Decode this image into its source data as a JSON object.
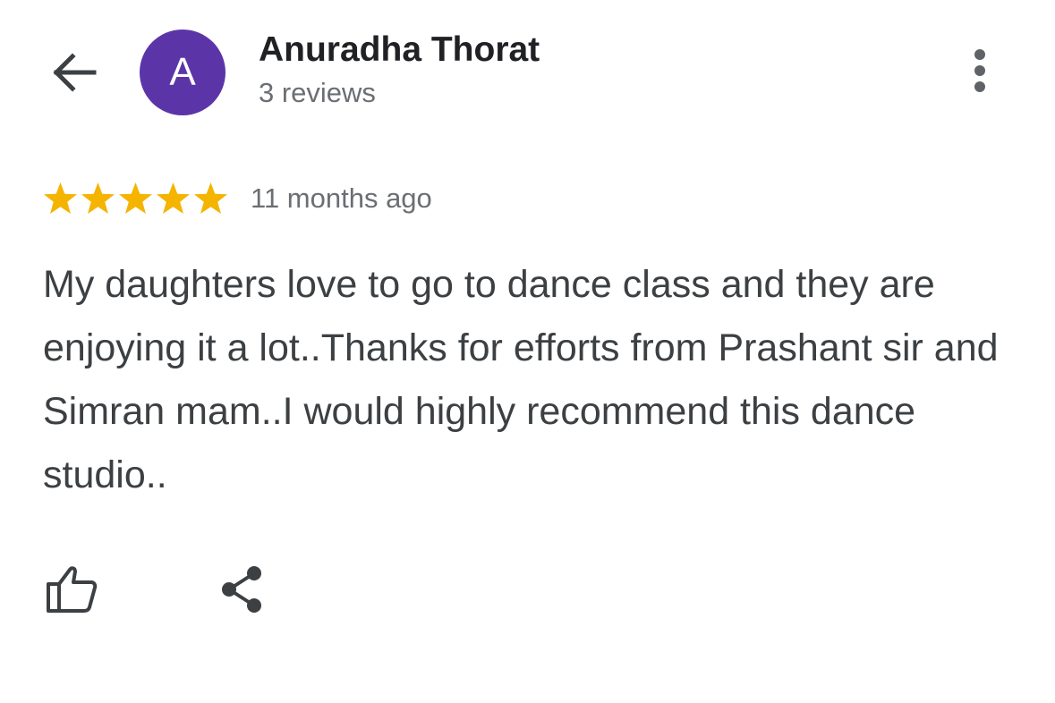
{
  "header": {
    "back_icon": "arrow-left-icon",
    "avatar_letter": "A",
    "avatar_color": "#5b35a8",
    "reviewer_name": "Anuradha Thorat",
    "review_count": "3 reviews",
    "menu_icon": "more-vert-icon"
  },
  "review": {
    "rating": 5,
    "max_rating": 5,
    "star_color": "#f4b400",
    "time_ago": "11 months ago",
    "text": "My daughters love to go to dance class and they are enjoying it a lot..Thanks for efforts from Prashant sir and Simran mam..I would highly recommend this dance studio.."
  },
  "actions": {
    "like_icon": "thumbs-up-icon",
    "share_icon": "share-icon"
  }
}
